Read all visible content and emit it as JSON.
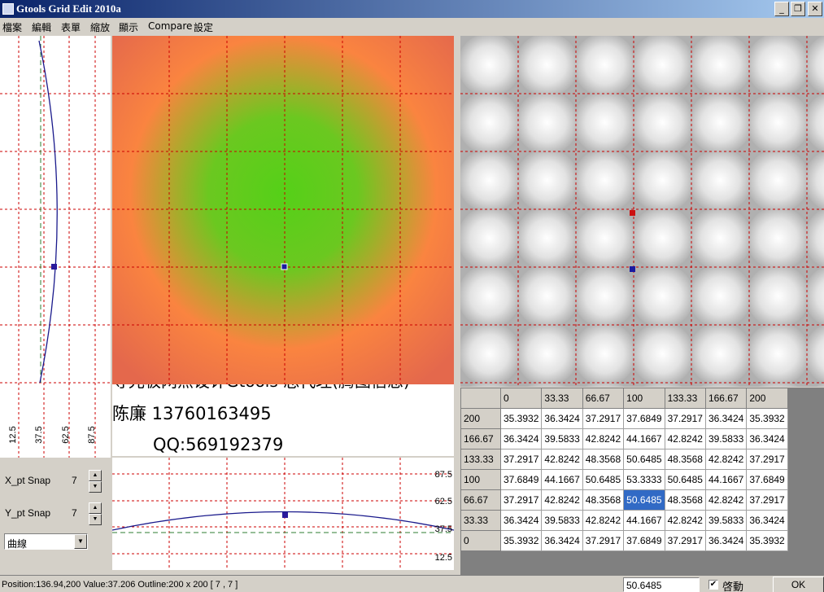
{
  "window": {
    "title": "Gtools Grid Edit 2010a"
  },
  "menu": [
    "檔案",
    "編輯",
    "表單",
    "縮放",
    "顯示",
    "Compare",
    "設定"
  ],
  "left_profile": {
    "ticks": [
      "12.5",
      "37.5",
      "62.5",
      "87.5"
    ]
  },
  "bottom_profile": {
    "ticks": [
      "87.5",
      "62.5",
      "37.5",
      "12.5"
    ]
  },
  "watermark": {
    "line1": "导光板网点设计Gtools 总代理(腾图信息)",
    "line2": "陈廉  13760163495",
    "line3": "QQ:569192379"
  },
  "controls": {
    "x_snap_label": "X_pt Snap",
    "x_snap_value": "7",
    "y_snap_label": "Y_pt Snap",
    "y_snap_value": "7",
    "curve_select": "曲線"
  },
  "table": {
    "col_headers": [
      "",
      "0",
      "33.33",
      "66.67",
      "100",
      "133.33",
      "166.67",
      "200"
    ],
    "rows": [
      {
        "label": "200",
        "values": [
          "35.3932",
          "36.3424",
          "37.2917",
          "37.6849",
          "37.2917",
          "36.3424",
          "35.3932"
        ]
      },
      {
        "label": "166.67",
        "values": [
          "36.3424",
          "39.5833",
          "42.8242",
          "44.1667",
          "42.8242",
          "39.5833",
          "36.3424"
        ]
      },
      {
        "label": "133.33",
        "values": [
          "37.2917",
          "42.8242",
          "48.3568",
          "50.6485",
          "48.3568",
          "42.8242",
          "37.2917"
        ]
      },
      {
        "label": "100",
        "values": [
          "37.6849",
          "44.1667",
          "50.6485",
          "53.3333",
          "50.6485",
          "44.1667",
          "37.6849"
        ]
      },
      {
        "label": "66.67",
        "values": [
          "37.2917",
          "42.8242",
          "48.3568",
          "50.6485",
          "48.3568",
          "42.8242",
          "37.2917"
        ]
      },
      {
        "label": "33.33",
        "values": [
          "36.3424",
          "39.5833",
          "42.8242",
          "44.1667",
          "42.8242",
          "39.5833",
          "36.3424"
        ]
      },
      {
        "label": "0",
        "values": [
          "35.3932",
          "36.3424",
          "37.2917",
          "37.6849",
          "37.2917",
          "36.3424",
          "35.3932"
        ]
      }
    ],
    "selected": {
      "row": 4,
      "col": 3
    }
  },
  "status": {
    "text": "Position:136.94,200 Value:37.206 Outline:200 x 200 [ 7 , 7 ]",
    "value_field": "50.6485",
    "checkbox_label": "啓動",
    "checkbox_checked": true,
    "ok_label": "OK"
  },
  "colors": {
    "grid_line": "#cc0000",
    "marker": "#1a1aa0",
    "selected_marker": "#cc1111",
    "curve": "#1a1a8c",
    "baseline": "#2e7d32"
  }
}
